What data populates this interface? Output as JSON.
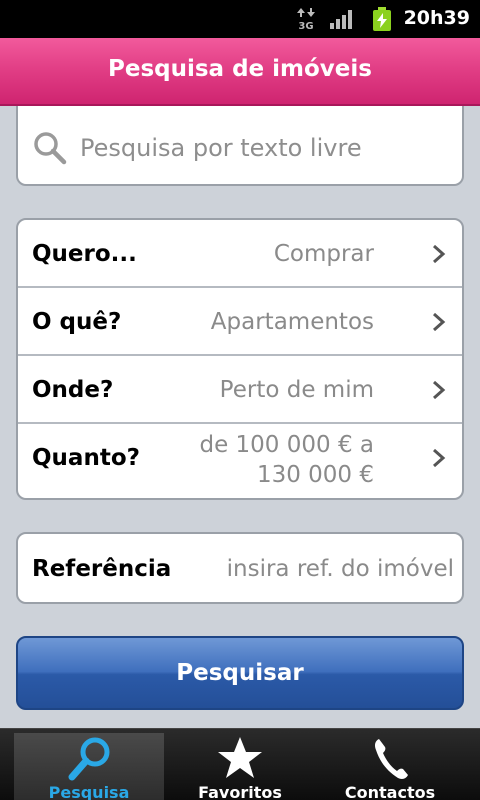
{
  "status_bar": {
    "time": "20h39",
    "network_label": "3G",
    "icons": [
      "data-transfer-icon",
      "signal-icon",
      "battery-charging-icon"
    ]
  },
  "header": {
    "title": "Pesquisa de imóveis"
  },
  "search": {
    "placeholder": "Pesquisa por texto livre",
    "value": ""
  },
  "filters": [
    {
      "label": "Quero...",
      "value": "Comprar"
    },
    {
      "label": "O quê?",
      "value": "Apartamentos"
    },
    {
      "label": "Onde?",
      "value": "Perto de mim"
    },
    {
      "label": "Quanto?",
      "value_line1": "de 100 000  € a",
      "value_line2": "130 000  €"
    }
  ],
  "reference": {
    "label": "Referência",
    "placeholder": "insira ref. do imóvel",
    "value": ""
  },
  "submit_label": "Pesquisar",
  "tabs": [
    {
      "label": "Pesquisa",
      "icon": "search-icon",
      "active": true
    },
    {
      "label": "Favoritos",
      "icon": "star-icon",
      "active": false
    },
    {
      "label": "Contactos",
      "icon": "phone-icon",
      "active": false
    }
  ],
  "colors": {
    "header_pink": "#e23f86",
    "button_blue": "#3f6fbd",
    "active_tab": "#2aa8e6",
    "background": "#cdd2d9"
  }
}
